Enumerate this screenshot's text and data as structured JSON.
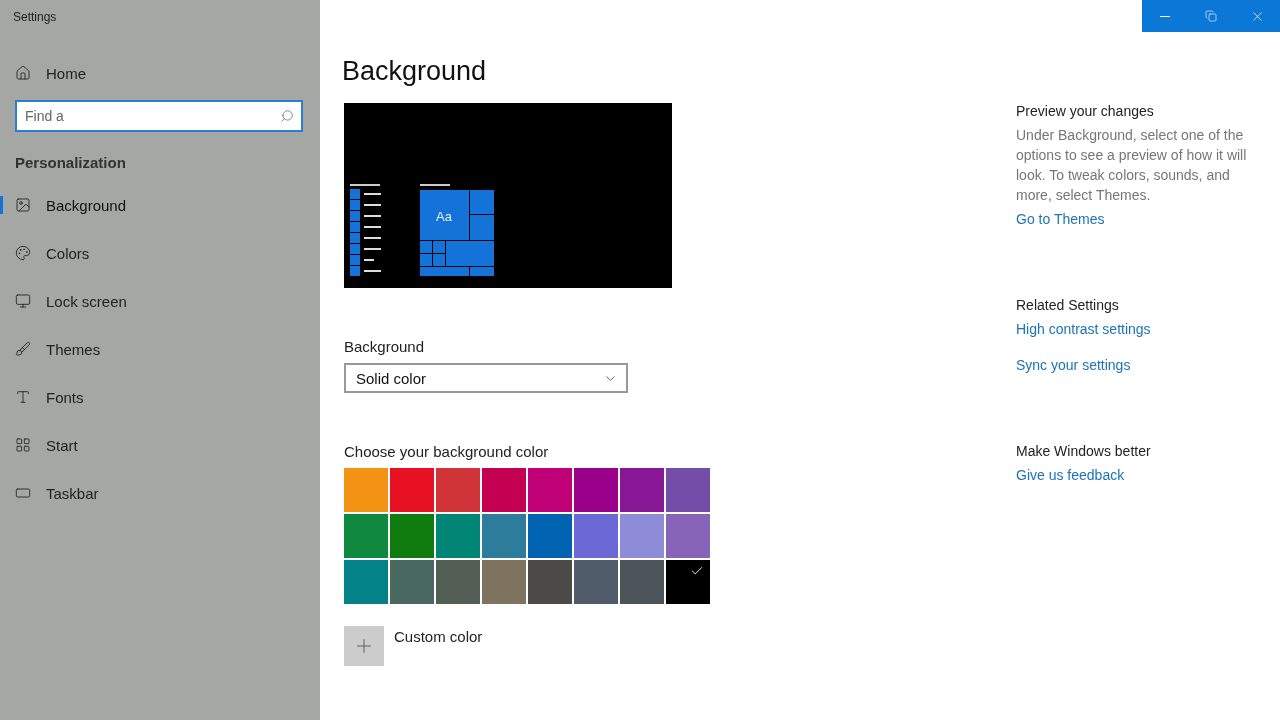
{
  "window": {
    "title": "Settings"
  },
  "sidebar": {
    "home": "Home",
    "search": {
      "placeholder": "Find a"
    },
    "section": "Personalization",
    "items": [
      {
        "label": "Background",
        "selected": true
      },
      {
        "label": "Colors",
        "selected": false
      },
      {
        "label": "Lock screen",
        "selected": false
      },
      {
        "label": "Themes",
        "selected": false
      },
      {
        "label": "Fonts",
        "selected": false
      },
      {
        "label": "Start",
        "selected": false
      },
      {
        "label": "Taskbar",
        "selected": false
      }
    ]
  },
  "main": {
    "heading": "Background",
    "preview": {
      "tile_label": "Aa"
    },
    "background_label": "Background",
    "background_select": {
      "value": "Solid color"
    },
    "color_label": "Choose your background color",
    "swatches": [
      {
        "color": "#f39314",
        "selected": false
      },
      {
        "color": "#e81123",
        "selected": false
      },
      {
        "color": "#d13438",
        "selected": false
      },
      {
        "color": "#c30052",
        "selected": false
      },
      {
        "color": "#bf0077",
        "selected": false
      },
      {
        "color": "#9a0089",
        "selected": false
      },
      {
        "color": "#881798",
        "selected": false
      },
      {
        "color": "#744da9",
        "selected": false
      },
      {
        "color": "#10893e",
        "selected": false
      },
      {
        "color": "#107c10",
        "selected": false
      },
      {
        "color": "#018574",
        "selected": false
      },
      {
        "color": "#2d7d9a",
        "selected": false
      },
      {
        "color": "#0063b1",
        "selected": false
      },
      {
        "color": "#6b69d6",
        "selected": false
      },
      {
        "color": "#8e8cd8",
        "selected": false
      },
      {
        "color": "#8764b8",
        "selected": false
      },
      {
        "color": "#038387",
        "selected": false
      },
      {
        "color": "#486860",
        "selected": false
      },
      {
        "color": "#525e54",
        "selected": false
      },
      {
        "color": "#7e735f",
        "selected": false
      },
      {
        "color": "#4c4a48",
        "selected": false
      },
      {
        "color": "#515c6b",
        "selected": false
      },
      {
        "color": "#4a5459",
        "selected": false
      },
      {
        "color": "#000000",
        "selected": true
      }
    ],
    "custom_color": "Custom color"
  },
  "aside": [
    {
      "title": "Preview your changes",
      "text": "Under Background, select one of the options to see a preview of how it will look. To tweak colors, sounds, and more, select Themes.",
      "links": [
        "Go to Themes"
      ]
    },
    {
      "title": "Related Settings",
      "links": [
        "High contrast settings",
        "Sync your settings"
      ]
    },
    {
      "title": "Make Windows better",
      "links": [
        "Give us feedback"
      ]
    }
  ]
}
